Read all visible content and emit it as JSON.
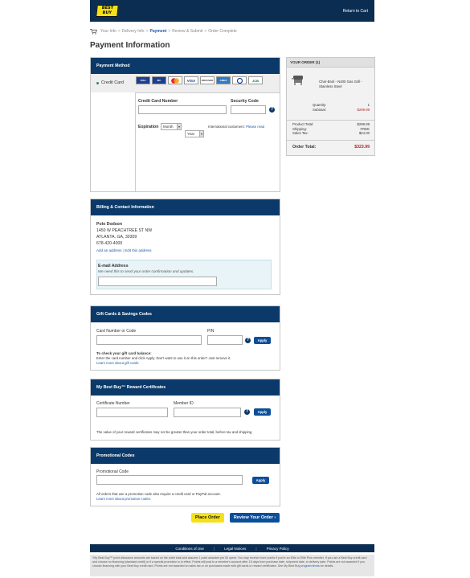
{
  "header": {
    "logo_line1": "BEST",
    "logo_line2": "BUY",
    "return_link": "Return to Cart"
  },
  "steps": {
    "items": [
      "Your Info",
      "Delivery Info",
      "Payment",
      "Review & Submit",
      "Order Complete"
    ],
    "current_index": 2,
    "separator": ">"
  },
  "page_title": "Payment Information",
  "payment_method": {
    "title": "Payment Method",
    "option_label": "Credit Card",
    "cards": [
      "VISA",
      "MC",
      "",
      "VISA",
      "DISCOVER",
      "AMEX",
      "",
      "JCB"
    ],
    "card_number_label": "Credit Card Number",
    "security_code_label": "Security Code",
    "help_icon": "?",
    "expiration_label": "Expiration",
    "month_value": "Month",
    "year_value": "Year",
    "intl_note": "International customers:",
    "intl_link": "Please read"
  },
  "billing": {
    "title": "Billing & Contact Information",
    "name": "Polo Dodson",
    "address1": "1450 W PEACHTREE ST NW",
    "address2": "ATLANTA, GA, 30309",
    "phone": "678-420-4000",
    "add_address_link": "Add an address",
    "edit_address_link": "Edit this address",
    "email_label": "E-mail Address",
    "email_note": "We need this to send your order confirmation and updates.",
    "email_value": ""
  },
  "gift_cards": {
    "title": "Gift Cards & Savings Codes",
    "card_number_label": "Card Number or Code",
    "pin_label": "PIN",
    "apply_label": "Apply",
    "balance_heading": "To check your gift card balance:",
    "balance_text": "Enter the card number and click Apply. Don't want to use it on this order? Just remove it.",
    "learn_more": "Learn more about gift cards"
  },
  "rewards": {
    "title": "My Best Buy™ Reward Certificates",
    "cert_label": "Certificate Number",
    "member_label": "Member ID",
    "apply_label": "Apply",
    "note": "The value of your reward certificates may not be greater than your order total, before tax and shipping."
  },
  "promo": {
    "title": "Promotional Codes",
    "code_label": "Promotional Code",
    "apply_label": "Apply",
    "note": "All orders that use a promotion code also require a credit card or PayPal account.",
    "learn_more": "Learn more about promotion codes."
  },
  "buttons": {
    "place_order": "Place Order",
    "review_order": "Review Your Order ›"
  },
  "order_summary": {
    "title": "YOUR ORDER (1)",
    "item_name": "Char-Broil - N400 Gas Grill - Stainless Steel",
    "quantity_label": "Quantity:",
    "quantity_value": "1",
    "subtotal_label": "Subtotal:",
    "subtotal_value": "$299.99",
    "product_total_label": "Product Total:",
    "product_total_value": "$299.99",
    "shipping_label": "Shipping:",
    "shipping_value": "FREE",
    "tax_label": "Sales Tax:",
    "tax_value": "$24.00",
    "order_total_label": "Order Total:",
    "order_total_value": "$323.99"
  },
  "footer": {
    "links": [
      "Conditions of Use",
      "Legal Notices",
      "Privacy Policy"
    ],
    "disclaimer": "*My Best Buy™ point allowance amounts are based on the order total and assume 1 point awarded per $1 spent. You may receive more points if you're an Elite or Elite Plus member. If you use a Best Buy credit card and choose no financing (standard credit) or if a special promotion is in effect. Points will post to a member's account after 15 days from purchase date, shipment date, or delivery date. Points are not awarded if you choose financing with your Best Buy credit card. Points are not awarded on sales tax or on purchases made with gift cards or reward certificates. See My Best Buy",
    "disclaimer_link": "program terms",
    "disclaimer_end": " for details."
  },
  "colors": {
    "header_bg": "#0b2d52",
    "section_head_bg": "#0b3a6a",
    "accent_red": "#b41f24",
    "button_yellow": "#f5e118",
    "button_blue": "#0b4e9a"
  }
}
